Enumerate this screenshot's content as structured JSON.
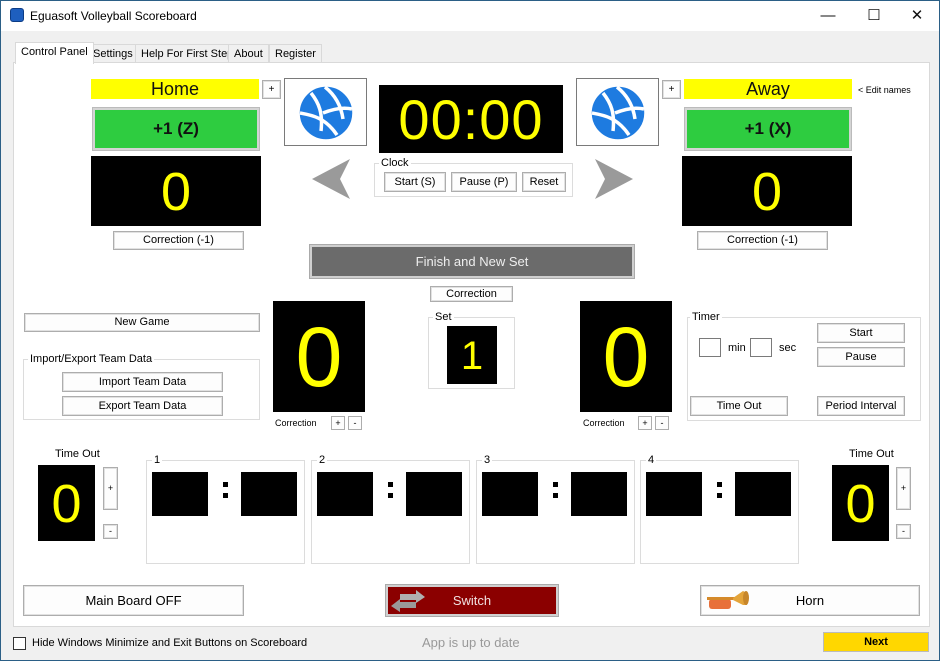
{
  "window": {
    "title": "Eguasoft Volleyball Scoreboard",
    "controls": {
      "minimize": "—",
      "maximize": "☐",
      "close": "✕"
    }
  },
  "tabs": [
    {
      "label": "Control Panel",
      "active": true
    },
    {
      "label": "Settings",
      "active": false
    },
    {
      "label": "Help For First Step",
      "active": false
    },
    {
      "label": "About",
      "active": false
    },
    {
      "label": "Register",
      "active": false
    }
  ],
  "home": {
    "name": "Home",
    "plus_label": "+",
    "add_point_label": "+1  (Z)",
    "score": "0",
    "correction_label": "Correction (-1)",
    "sets_won": "0",
    "sets_correction_label": "Correction",
    "sets_plus": "+",
    "sets_minus": "-",
    "timeout_label": "Time Out",
    "timeouts": "0",
    "timeout_plus": "+",
    "timeout_minus": "-"
  },
  "away": {
    "name": "Away",
    "plus_label": "+",
    "add_point_label": "+1  (X)",
    "score": "0",
    "correction_label": "Correction (-1)",
    "sets_won": "0",
    "sets_correction_label": "Correction",
    "sets_plus": "+",
    "sets_minus": "-",
    "timeout_label": "Time Out",
    "timeouts": "0",
    "timeout_plus": "+",
    "timeout_minus": "-"
  },
  "edit_names_label": "< Edit names",
  "clock": {
    "display": "00:00",
    "group_label": "Clock",
    "start_label": "Start (S)",
    "pause_label": "Pause (P)",
    "reset_label": "Reset"
  },
  "serve_indicator": {
    "left_arrow": "serve-left",
    "right_arrow": "serve-right"
  },
  "finish_set_label": "Finish and New Set",
  "set_correction_label": "Correction",
  "set": {
    "group_label": "Set",
    "value": "1"
  },
  "new_game_label": "New Game",
  "import_export": {
    "group_label": "Import/Export Team Data",
    "import_label": "Import Team Data",
    "export_label": "Export Team Data"
  },
  "timer": {
    "group_label": "Timer",
    "min_value": "",
    "min_label": "min",
    "sec_value": "",
    "sec_label": "sec",
    "start_label": "Start",
    "pause_label": "Pause",
    "timeout_label": "Time Out",
    "period_interval_label": "Period Interval"
  },
  "set_history": [
    {
      "label": "1",
      "home": "",
      "away": ""
    },
    {
      "label": "2",
      "home": "",
      "away": ""
    },
    {
      "label": "3",
      "home": "",
      "away": ""
    },
    {
      "label": "4",
      "home": "",
      "away": ""
    }
  ],
  "main_board_label": "Main Board OFF",
  "switch_label": "Switch",
  "horn_label": "Horn",
  "footer": {
    "hide_buttons_label": "Hide Windows Minimize and Exit Buttons on Scoreboard",
    "hide_buttons_checked": false,
    "status_text": "App is up to date",
    "next_label": "Next"
  },
  "colors": {
    "score_digit": "#ffff00",
    "name_bar": "#ffff00",
    "point_button": "#2ecc40",
    "finish_button": "#6b6b6b",
    "switch_button": "#8b0000",
    "next_button": "#ffd700",
    "ball": "#1e7be0"
  }
}
